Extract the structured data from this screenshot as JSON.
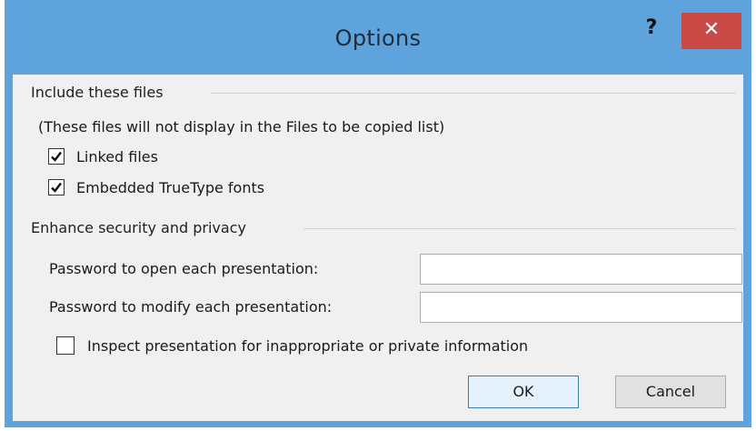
{
  "window": {
    "title": "Options",
    "help_label": "?",
    "close_label": "✕",
    "title_bar_color": "#5ea3dc",
    "close_button_color": "#c94a47"
  },
  "include_files": {
    "header": "Include these files",
    "note": "(These files will not display in the Files to be copied list)",
    "linked_files": {
      "label": "Linked files",
      "checked": true
    },
    "embedded_fonts": {
      "label": "Embedded TrueType fonts",
      "checked": true
    }
  },
  "security": {
    "header": "Enhance security and privacy",
    "open_password": {
      "label": "Password to open each presentation:",
      "value": ""
    },
    "modify_password": {
      "label": "Password to modify each presentation:",
      "value": ""
    },
    "inspect": {
      "label": "Inspect presentation for inappropriate or private information",
      "checked": false
    }
  },
  "buttons": {
    "ok": "OK",
    "cancel": "Cancel"
  }
}
